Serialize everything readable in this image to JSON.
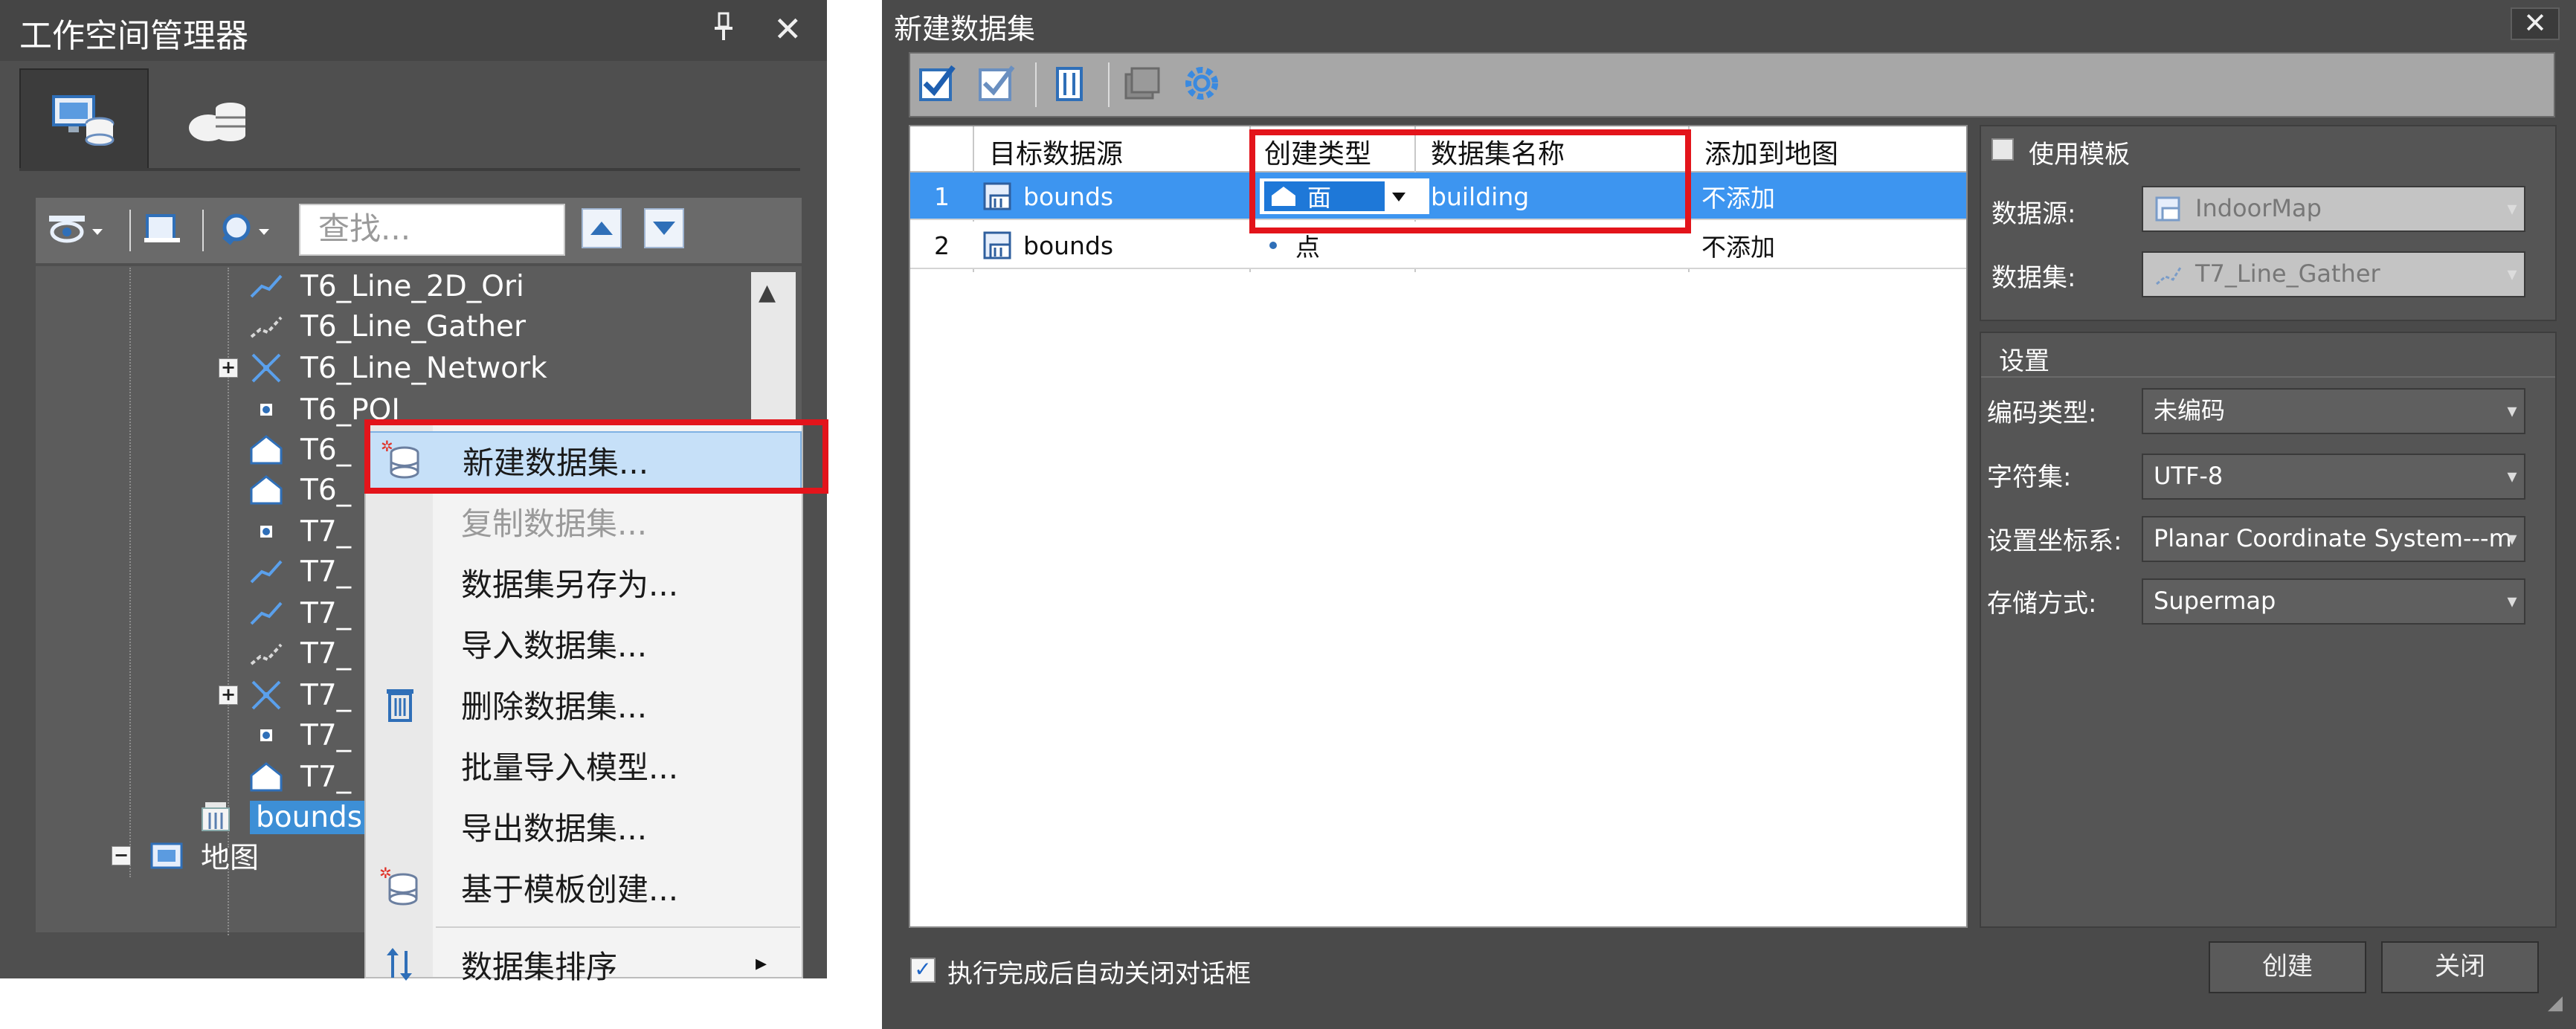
{
  "workspace": {
    "title": "工作空间管理器",
    "pin_icon": "pin-icon",
    "close_symbol": "✕",
    "search_placeholder": "查找...",
    "tree": [
      {
        "label": "T6_Line_2D_Ori",
        "icon": "line-dataset-icon"
      },
      {
        "label": "T6_Line_Gather",
        "icon": "gather-line-dataset-icon"
      },
      {
        "label": "T6_Line_Network",
        "icon": "network-dataset-icon",
        "expander": "+"
      },
      {
        "label": "T6_POI",
        "icon": "point-dataset-icon"
      },
      {
        "label": "T6_",
        "icon": "region-dataset-icon"
      },
      {
        "label": "T6_",
        "icon": "region-dataset-icon"
      },
      {
        "label": "T7_",
        "icon": "point-dataset-icon"
      },
      {
        "label": "T7_",
        "icon": "line-dataset-icon"
      },
      {
        "label": "T7_",
        "icon": "line-dataset-icon"
      },
      {
        "label": "T7_",
        "icon": "gather-line-dataset-icon"
      },
      {
        "label": "T7_",
        "icon": "network-dataset-icon",
        "expander": "+"
      },
      {
        "label": "T7_",
        "icon": "point-dataset-icon"
      },
      {
        "label": "T7_",
        "icon": "region-dataset-icon"
      },
      {
        "label": "bounds",
        "icon": "datasource-icon"
      },
      {
        "label": "地图",
        "icon": "map-icon",
        "expander": "−"
      }
    ]
  },
  "context_menu": {
    "items": [
      {
        "label": "新建数据集...",
        "icon": "new-dataset-icon",
        "state": "highlighted"
      },
      {
        "label": "复制数据集...",
        "icon": "",
        "state": "disabled"
      },
      {
        "label": "数据集另存为...",
        "icon": "",
        "state": "normal"
      },
      {
        "label": "导入数据集...",
        "icon": "",
        "state": "normal"
      },
      {
        "label": "删除数据集...",
        "icon": "trash-icon",
        "state": "normal"
      },
      {
        "label": "批量导入模型...",
        "icon": "",
        "state": "normal"
      },
      {
        "label": "导出数据集...",
        "icon": "",
        "state": "normal"
      },
      {
        "label": "基于模板创建...",
        "icon": "template-dataset-icon",
        "state": "normal"
      },
      {
        "label": "数据集排序",
        "icon": "sort-icon",
        "state": "submenu"
      }
    ],
    "submenu_arrow": "▸"
  },
  "dialog": {
    "title": "新建数据集",
    "close_symbol": "✕",
    "grid": {
      "headers": [
        "",
        "目标数据源",
        "创建类型",
        "数据集名称",
        "添加到地图"
      ],
      "rows": [
        {
          "index": "1",
          "datasource": "bounds",
          "type": "面",
          "name": "building",
          "add_to_map": "不添加",
          "selected": true
        },
        {
          "index": "2",
          "datasource": "bounds",
          "type": "点",
          "name": "",
          "add_to_map": "不添加",
          "selected": false
        }
      ],
      "dropdown_symbol": "▾"
    },
    "template": {
      "checkbox_label": "使用模板",
      "checked": false,
      "datasource_label": "数据源:",
      "datasource_value": "IndoorMap",
      "dataset_label": "数据集:",
      "dataset_value": "T7_Line_Gather"
    },
    "settings": {
      "group_title": "设置",
      "encoding_label": "编码类型:",
      "encoding_value": "未编码",
      "charset_label": "字符集:",
      "charset_value": "UTF-8",
      "coord_label": "设置坐标系:",
      "coord_value": "Planar Coordinate System---m",
      "storage_label": "存储方式:",
      "storage_value": "Supermap"
    },
    "autoclose_label": "执行完成后自动关闭对话框",
    "autoclose_checked": true,
    "create_button": "创建",
    "close_button": "关闭"
  },
  "colors": {
    "highlight_box": "#e3141b",
    "selection_blue": "#3d95f0",
    "menu_hover": "#c6e0f8"
  }
}
